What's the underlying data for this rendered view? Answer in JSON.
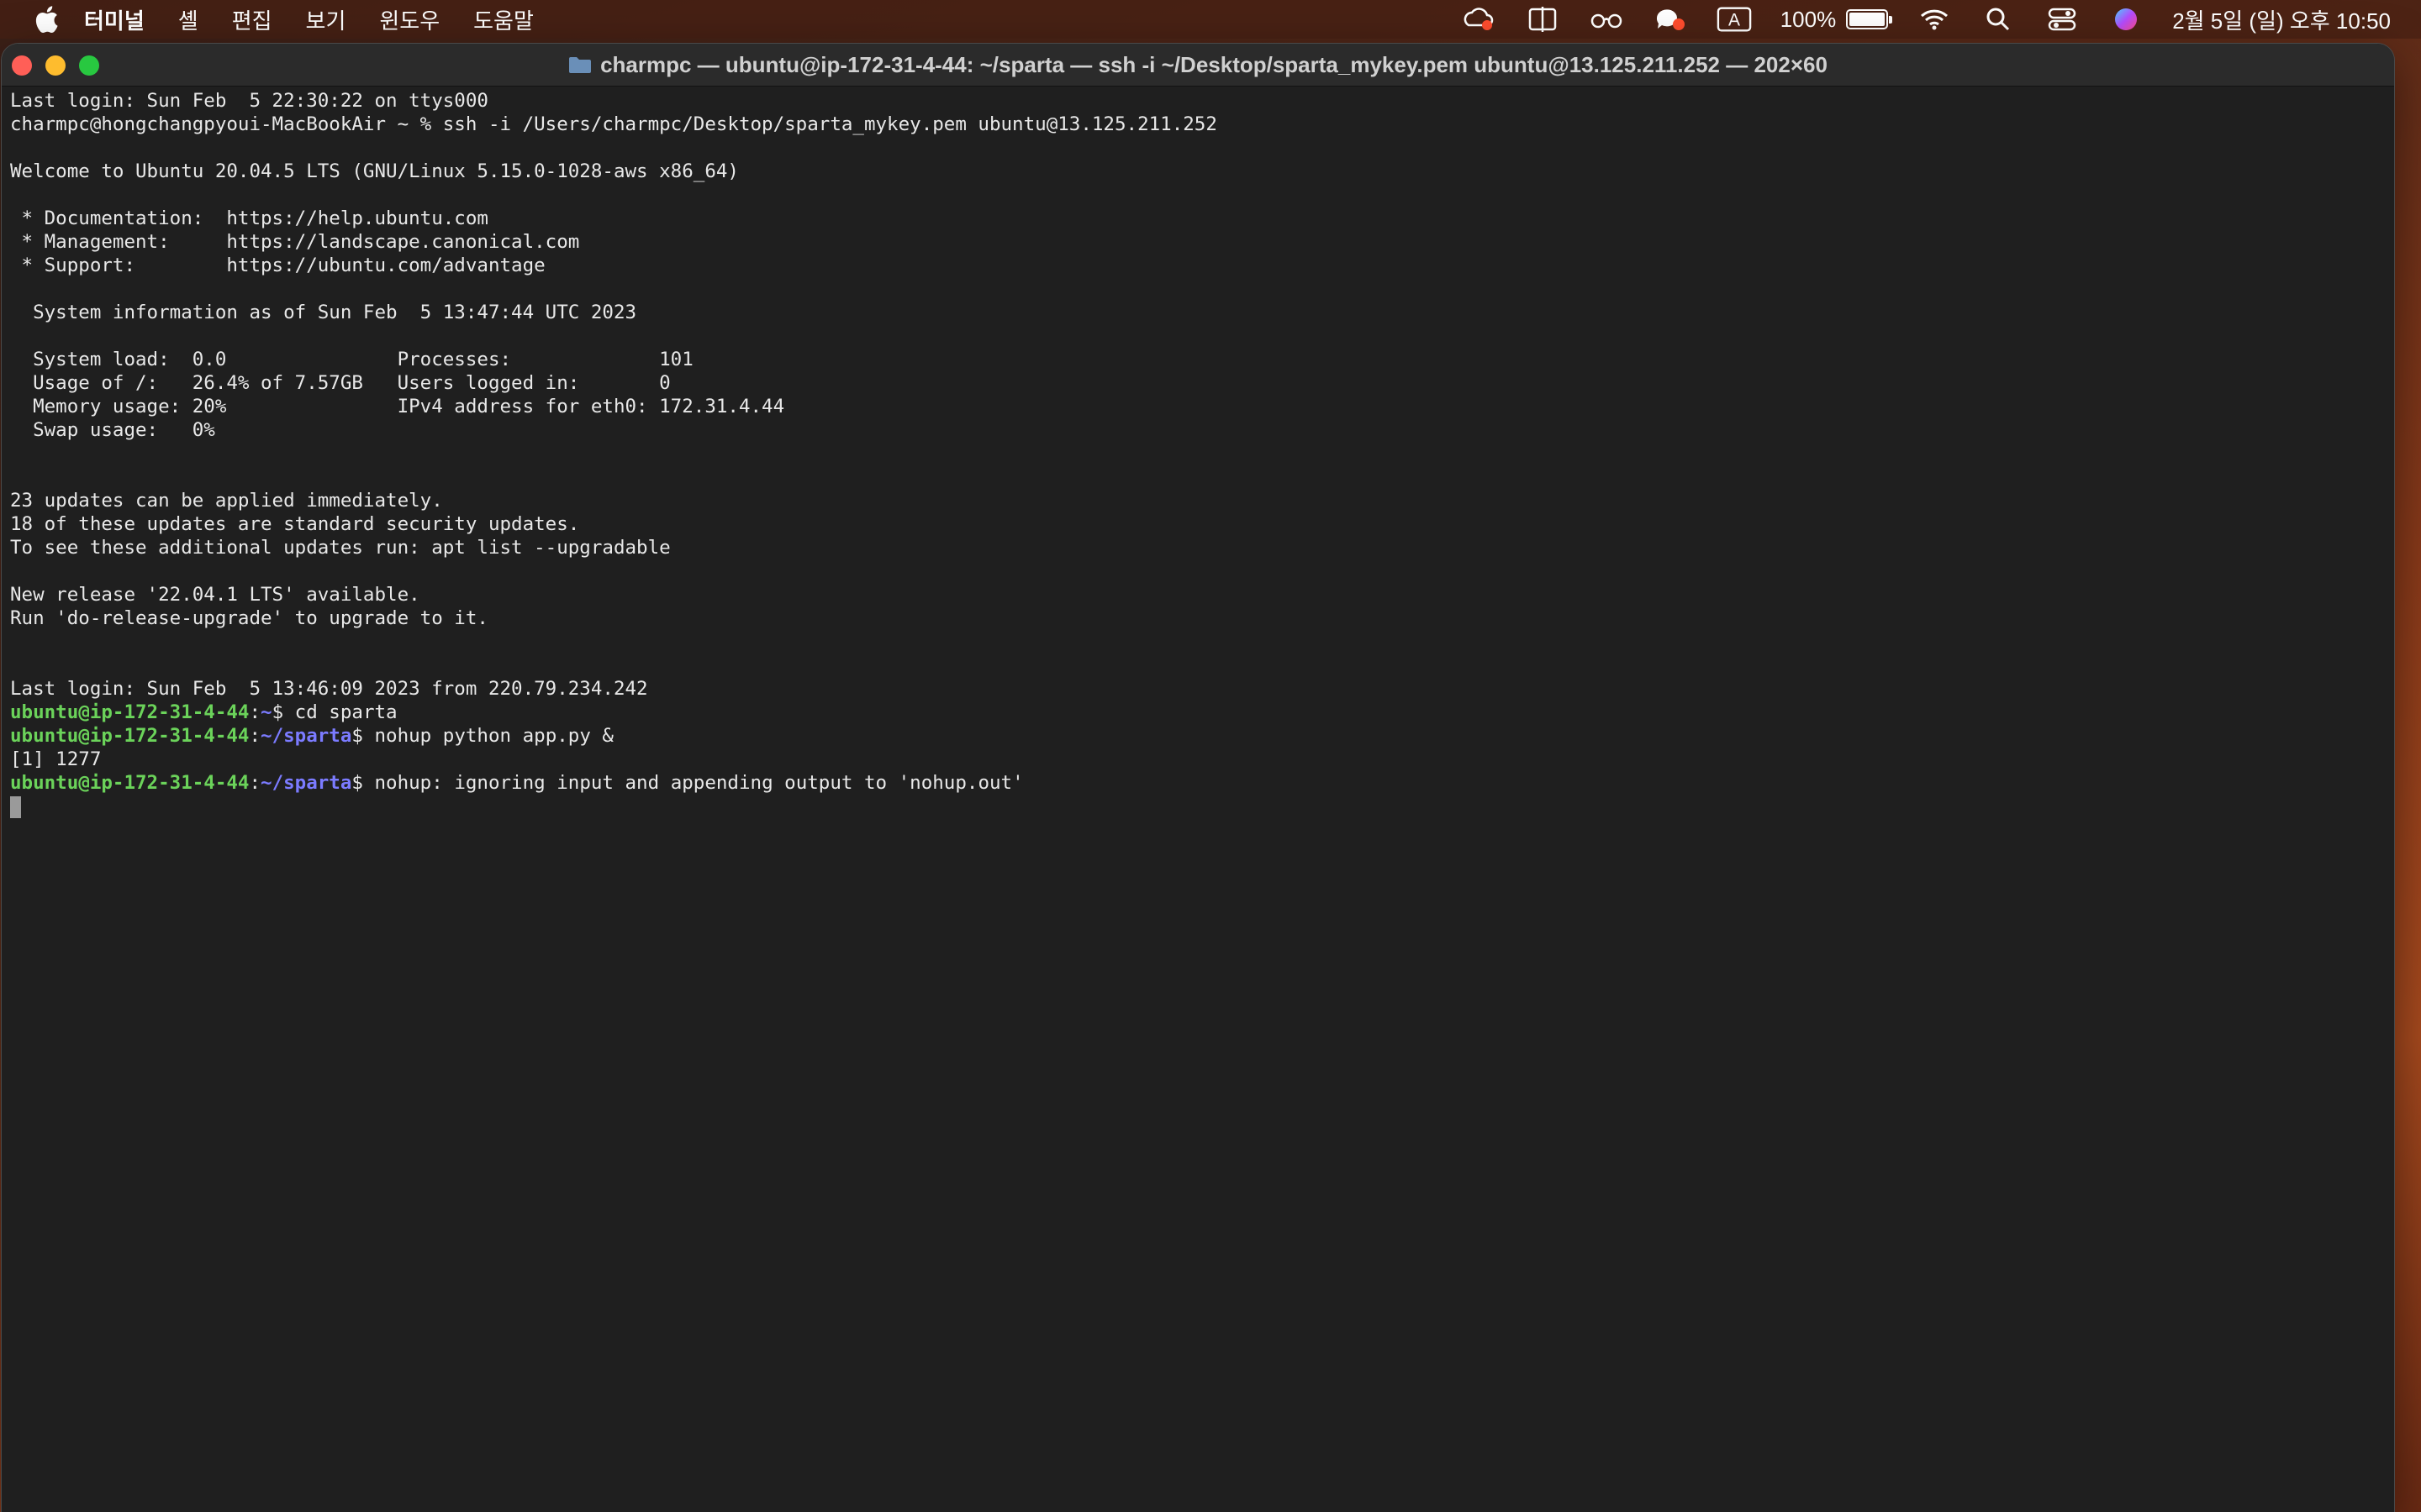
{
  "menubar": {
    "app": "터미널",
    "items": [
      "셸",
      "편집",
      "보기",
      "윈도우",
      "도움말"
    ],
    "battery_percent": "100%",
    "battery_level": 1.0,
    "datetime": "2월 5일 (일) 오후 10:50",
    "input_source": "A",
    "icons": [
      "apple-icon",
      "creative-cloud-icon",
      "split-view-icon",
      "glasses-icon",
      "chat-icon",
      "input-source-icon",
      "battery-icon",
      "wifi-icon",
      "spotlight-icon",
      "control-center-icon",
      "siri-icon"
    ]
  },
  "window": {
    "title": "charmpc — ubuntu@ip-172-31-4-44: ~/sparta — ssh -i ~/Desktop/sparta_mykey.pem ubuntu@13.125.211.252 — 202×60"
  },
  "terminal": {
    "l01": "Last login: Sun Feb  5 22:30:22 on ttys000",
    "l02": "charmpc@hongchangpyoui-MacBookAir ~ % ssh -i /Users/charmpc/Desktop/sparta_mykey.pem ubuntu@13.125.211.252",
    "l03": "",
    "l04": "Welcome to Ubuntu 20.04.5 LTS (GNU/Linux 5.15.0-1028-aws x86_64)",
    "l05": "",
    "l06": " * Documentation:  https://help.ubuntu.com",
    "l07": " * Management:     https://landscape.canonical.com",
    "l08": " * Support:        https://ubuntu.com/advantage",
    "l09": "",
    "l10": "  System information as of Sun Feb  5 13:47:44 UTC 2023",
    "l11": "",
    "l12": "  System load:  0.0               Processes:             101",
    "l13": "  Usage of /:   26.4% of 7.57GB   Users logged in:       0",
    "l14": "  Memory usage: 20%               IPv4 address for eth0: 172.31.4.44",
    "l15": "  Swap usage:   0%",
    "l16": "",
    "l17": "",
    "l18": "23 updates can be applied immediately.",
    "l19": "18 of these updates are standard security updates.",
    "l20": "To see these additional updates run: apt list --upgradable",
    "l21": "",
    "l22": "New release '22.04.1 LTS' available.",
    "l23": "Run 'do-release-upgrade' to upgrade to it.",
    "l24": "",
    "l25": "",
    "l26": "Last login: Sun Feb  5 13:46:09 2023 from 220.79.234.242",
    "prompt_user": "ubuntu@ip-172-31-4-44",
    "prompt_sep": ":",
    "prompt_home": "~",
    "prompt_sparta": "~/sparta",
    "prompt_dollar": "$",
    "cmd1": " cd sparta",
    "cmd2": " nohup python app.py &",
    "job": "[1] 1277",
    "cmd3": " nohup: ignoring input and appending output to 'nohup.out'"
  }
}
